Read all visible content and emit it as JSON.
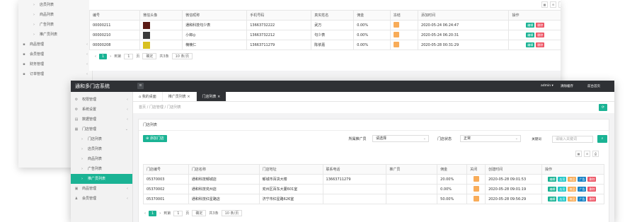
{
  "back": {
    "sidebar": [
      {
        "label": "店员列表",
        "sub": true
      },
      {
        "label": "商品列表",
        "sub": true
      },
      {
        "label": "广告列表",
        "sub": true
      },
      {
        "label": "推广员列表",
        "sub": true
      },
      {
        "label": "商品管理",
        "sub": false
      },
      {
        "label": "会员管理",
        "sub": false
      },
      {
        "label": "财务管理",
        "sub": false
      },
      {
        "label": "订单管理",
        "sub": false
      }
    ],
    "headers": [
      "编号",
      "微信头像",
      "微信昵称",
      "手机号码",
      "真实姓名",
      "佣金",
      "冻结",
      "添加时间",
      "操作"
    ],
    "rows": [
      {
        "id": "00000211",
        "nick": "通和科技句少表",
        "phone": "13663732222",
        "name": "武万",
        "commission": "0.00%",
        "time": "2020-05-24 06:24:47"
      },
      {
        "id": "00000210",
        "nick": "小郎◎",
        "phone": "13663732212",
        "name": "句少表",
        "commission": "0.00%",
        "time": "2020-05-24 06:20:31"
      },
      {
        "id": "00000208",
        "nick": "楠楠仁",
        "phone": "13663711279",
        "name": "陈依嘉",
        "commission": "0.00%",
        "time": "2020-05-28 00:31:29"
      }
    ],
    "edit": "编辑",
    "del": "删除",
    "pager": {
      "current": "1",
      "to": "到第",
      "page": "1",
      "unit": "页",
      "confirm": "确定",
      "total": "共3条",
      "size": "10 条/页"
    }
  },
  "top": {
    "title": "通和多门店系统",
    "menu": "≡",
    "admin": "admin ▾",
    "clear": "清除缓存",
    "home": "前台首页"
  },
  "sidebar": [
    {
      "label": "权限管理",
      "glyph": "⚙",
      "sub": false
    },
    {
      "label": "系统设置",
      "glyph": "⚙",
      "sub": false
    },
    {
      "label": "数据管理",
      "glyph": "▤",
      "sub": false
    },
    {
      "label": "门店管理",
      "glyph": "▦",
      "sub": false
    },
    {
      "label": "门店列表",
      "glyph": "›",
      "sub": true
    },
    {
      "label": "店员列表",
      "glyph": "›",
      "sub": true
    },
    {
      "label": "商品列表",
      "glyph": "›",
      "sub": true
    },
    {
      "label": "广告列表",
      "glyph": "›",
      "sub": true
    },
    {
      "label": "推广员列表",
      "glyph": "›",
      "sub": true,
      "active": true
    },
    {
      "label": "商品管理",
      "glyph": "▣",
      "sub": false
    },
    {
      "label": "会员管理",
      "glyph": "♟",
      "sub": false
    }
  ],
  "tabs": [
    {
      "label": "⌂ 我的桌面"
    },
    {
      "label": "推广员列表 ×"
    },
    {
      "label": "门店列表 ×",
      "active": true
    }
  ],
  "breadcrumb": "首页  /  门店管理  /  门店列表",
  "panel_title": "门店列表",
  "add_btn": "⊕ 添加门店",
  "filters": {
    "promoter_label": "所属推广员",
    "promoter_value": "请选择",
    "status_label": "门店状态",
    "status_value": "正常",
    "keyword_label": "关键词",
    "keyword_placeholder": "请输入关键词"
  },
  "headers": [
    "门店编号",
    "门店名称",
    "门店地址",
    "联系电话",
    "推广员",
    "佣金",
    "关闭",
    "创建时间",
    "操作"
  ],
  "rows": [
    {
      "id": "05370003",
      "name": "通和科技郁城店",
      "addr": "郁城市百货大楼",
      "phone": "13663711279",
      "promoter": "",
      "commission": "20.00%",
      "time": "2020-05-28 09:01:53"
    },
    {
      "id": "05370002",
      "name": "通和科技兖州店",
      "addr": "兖州区百东大厦601室",
      "phone": "",
      "promoter": "",
      "commission": "0.00%",
      "time": "2020-05-28 09:01:19"
    },
    {
      "id": "05370001",
      "name": "通和科技红星路店",
      "addr": "济宁市红星路626室",
      "phone": "",
      "promoter": "",
      "commission": "50.00%",
      "time": "2020-05-28 09:56:29"
    }
  ],
  "actions": {
    "edit": "编辑",
    "store": "店员",
    "goods": "商品",
    "ad": "广告",
    "del": "删除"
  },
  "pager": {
    "current": "1",
    "to": "到第",
    "page": "1",
    "unit": "页",
    "confirm": "确定",
    "total": "共3条",
    "size": "10 条/页"
  }
}
